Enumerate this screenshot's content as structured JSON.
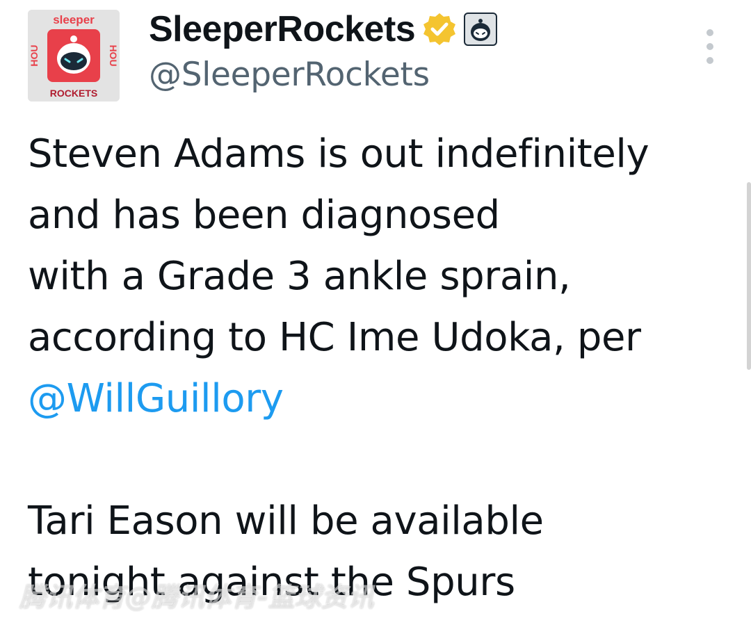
{
  "author": {
    "display_name": "SleeperRockets",
    "handle": "@SleeperRockets",
    "avatar": {
      "top_text": "sleeper",
      "bottom_text": "ROCKETS",
      "side_text": "HOU"
    },
    "verified_icon": "verified-badge-icon",
    "affiliate_icon": "affiliate-robot-icon"
  },
  "menu": {
    "icon": "more-vertical-icon"
  },
  "tweet": {
    "lines": [
      "Steven Adams is out indefinitely",
      "and has been diagnosed",
      "with a Grade 3 ankle sprain,",
      "according to HC Ime Udoka, per"
    ],
    "mention": "@WillGuillory",
    "lines2": [
      "Tari Eason will be available",
      "tonight against the Spurs"
    ]
  },
  "watermark": "腾讯体育@腾讯体育-篮球资讯",
  "colors": {
    "text": "#0f1419",
    "secondary": "#536471",
    "link": "#1d9bf0",
    "badge_gold": "#f4c430",
    "avatar_red": "#e8404a"
  }
}
